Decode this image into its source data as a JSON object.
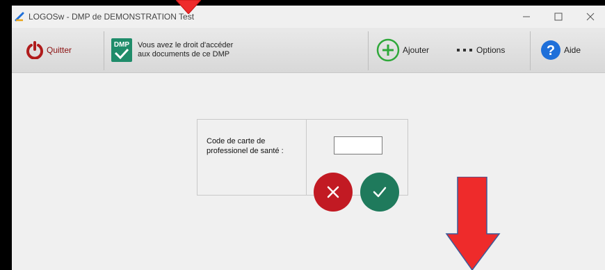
{
  "window": {
    "title": "LOGOSw - DMP de DEMONSTRATION Test",
    "controls": [
      "minimize",
      "maximize",
      "close"
    ]
  },
  "toolbar": {
    "quit_label": "Quitter",
    "dmp_badge": "DMP",
    "dmp_message_line1": "Vous avez le droit d'accéder",
    "dmp_message_line2": "aux documents de ce DMP",
    "add_label": "Ajouter",
    "options_label": "Options",
    "help_label": "Aide"
  },
  "form": {
    "code_label_line1": "Code de carte de",
    "code_label_line2": "professionel de santé :",
    "code_value": ""
  },
  "colors": {
    "quit_red": "#b01c1c",
    "cancel_red": "#c21a23",
    "confirm_green": "#1f7a5c",
    "add_green": "#2fa83a",
    "help_blue": "#1e6fd9",
    "annotation_arrow": "#ee2b2b"
  },
  "icons": [
    "app-logo-icon",
    "power-icon",
    "dmp-check-icon",
    "plus-circle-icon",
    "dots-icon",
    "question-icon",
    "x-icon",
    "check-icon",
    "red-arrow-down"
  ]
}
